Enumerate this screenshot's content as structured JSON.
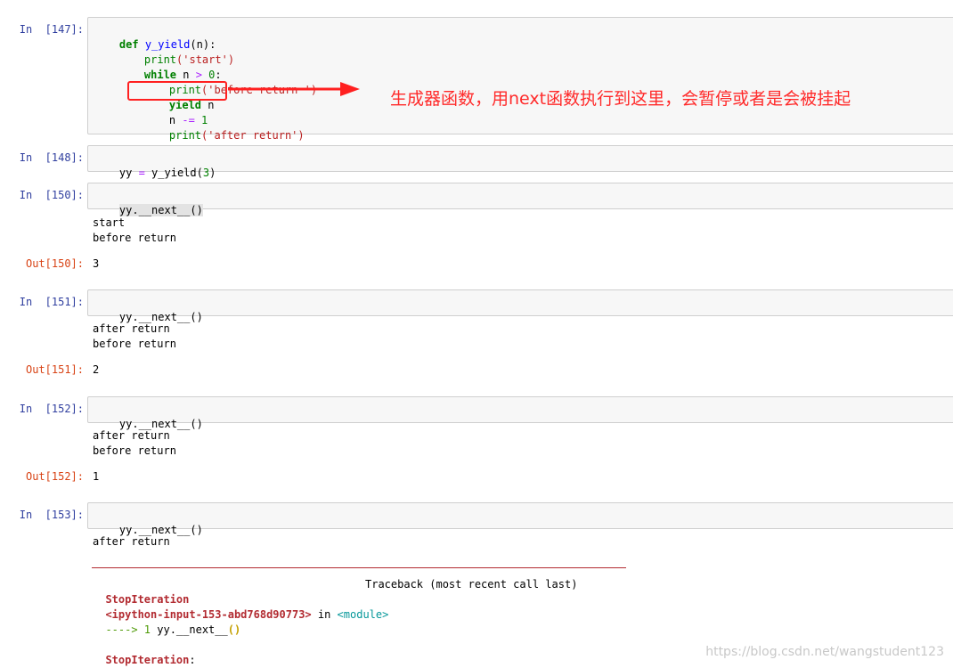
{
  "cells": [
    {
      "in_label": "In  [147]:",
      "code": {
        "l1_def": "def",
        "l1_name": "y_yield",
        "l1_rest": "(n):",
        "l2_print": "print",
        "l2_str": "('start')",
        "l3_while": "while",
        "l3_n": " n ",
        "l3_op": ">",
        "l3_num": " 0",
        "l3_colon": ":",
        "l4_print": "print",
        "l4_str": "('before return ')",
        "l5_yield": "yield",
        "l5_rest": " n",
        "l6_n": "n ",
        "l6_op": "-=",
        "l6_num": " 1",
        "l7_print": "print",
        "l7_str": "('after return')"
      }
    },
    {
      "in_label": "In  [148]:",
      "code": {
        "a": "yy ",
        "op": "=",
        "b": " y_yield",
        "paren": "(",
        "num": "3",
        "close": ")"
      }
    },
    {
      "in_label": "In  [150]:",
      "code": "yy.__next__()",
      "stdout": [
        "start",
        "before return"
      ],
      "out_label": "Out[150]:",
      "result": "3"
    },
    {
      "in_label": "In  [151]:",
      "code": "yy.__next__()",
      "stdout": [
        "after return",
        "before return"
      ],
      "out_label": "Out[151]:",
      "result": "2"
    },
    {
      "in_label": "In  [152]:",
      "code": "yy.__next__()",
      "stdout": [
        "after return",
        "before return"
      ],
      "out_label": "Out[152]:",
      "result": "1"
    },
    {
      "in_label": "In  [153]:",
      "code": "yy.__next__()",
      "stdout": [
        "after return"
      ],
      "traceback": {
        "error": "StopIteration",
        "header": "Traceback (most recent call last)",
        "file": "<ipython-input-153-abd768d90773>",
        "in_word": " in ",
        "module": "<module>",
        "arrow": "----> 1",
        "line_code": " yy.__next__",
        "line_paren": "()",
        "final": "StopIteration",
        "final_colon": ":"
      }
    }
  ],
  "annotation": "生成器函数，用next函数执行到这里，会暂停或者是会被挂起",
  "watermark": "https://blog.csdn.net/wangstudent123",
  "colors": {
    "annotation": "#ff2a2a",
    "prompt_in": "#303f9f",
    "prompt_out": "#d84315"
  }
}
